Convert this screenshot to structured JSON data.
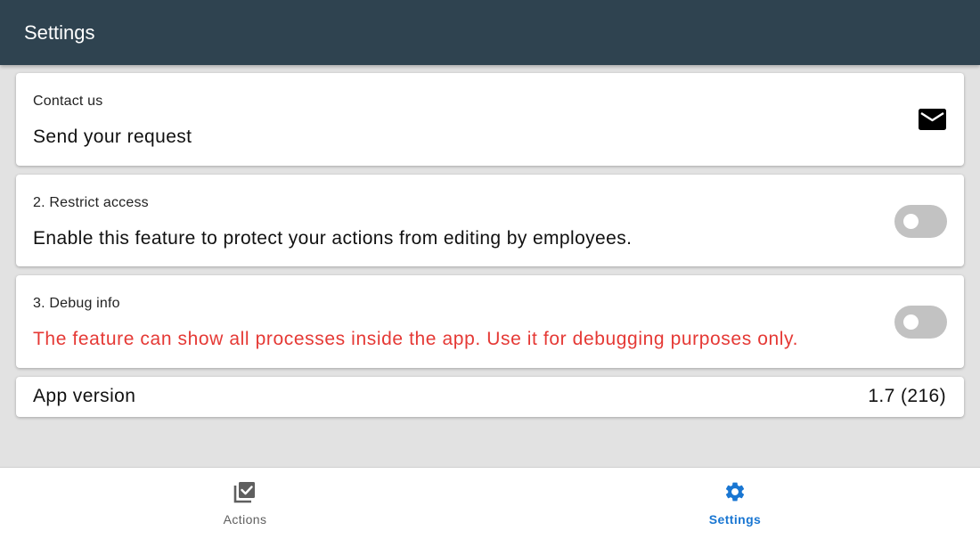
{
  "appbar": {
    "title": "Settings"
  },
  "cards": {
    "contact": {
      "label": "Contact us",
      "text": "Send your request",
      "icon": "mail-icon"
    },
    "restrict": {
      "label": "2. Restrict access",
      "text": "Enable this feature to protect your actions from editing by employees.",
      "enabled": false
    },
    "debug": {
      "label": "3. Debug info",
      "text": "The feature can show all processes inside the app. Use it for debugging purposes only.",
      "enabled": false
    },
    "version": {
      "label": "App version",
      "value": "1.7 (216)"
    }
  },
  "bottom_nav": {
    "items": [
      {
        "label": "Actions",
        "icon": "checklist-icon",
        "active": false
      },
      {
        "label": "Settings",
        "icon": "gear-icon",
        "active": true
      }
    ]
  },
  "colors": {
    "appbar": "#2f4350",
    "warning_text": "#e53935",
    "active_nav": "#1976d2",
    "inactive_nav": "#5f5f5f",
    "toggle_off": "#c2c2c2",
    "background": "#e2e2e2"
  }
}
